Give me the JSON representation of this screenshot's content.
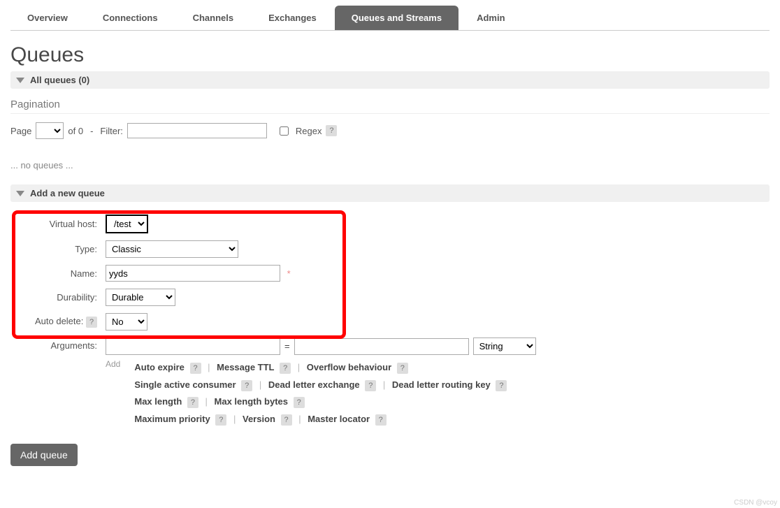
{
  "tabs": {
    "overview": "Overview",
    "connections": "Connections",
    "channels": "Channels",
    "exchanges": "Exchanges",
    "queues": "Queues and Streams",
    "admin": "Admin"
  },
  "page_title": "Queues",
  "section_all_queues": "All queues (0)",
  "pagination": {
    "heading": "Pagination",
    "page_label": "Page",
    "of_text": "of 0",
    "dash": "-",
    "filter_label": "Filter:",
    "regex_label": "Regex",
    "help": "?"
  },
  "no_queues": "... no queues ...",
  "section_add": "Add a new queue",
  "form": {
    "vhost_label": "Virtual host:",
    "vhost_value": "/test",
    "type_label": "Type:",
    "type_value": "Classic",
    "name_label": "Name:",
    "name_value": "yyds",
    "required": "*",
    "durability_label": "Durability:",
    "durability_value": "Durable",
    "autodelete_label": "Auto delete:",
    "autodelete_value": "No",
    "help": "?",
    "arguments_label": "Arguments:",
    "equals": "=",
    "argtype_value": "String",
    "add_text": "Add"
  },
  "shortcuts": {
    "auto_expire": "Auto expire",
    "message_ttl": "Message TTL",
    "overflow": "Overflow behaviour",
    "single_active": "Single active consumer",
    "dlx": "Dead letter exchange",
    "dlrk": "Dead letter routing key",
    "max_length": "Max length",
    "max_length_bytes": "Max length bytes",
    "max_priority": "Maximum priority",
    "version": "Version",
    "master_locator": "Master locator",
    "help": "?"
  },
  "submit_label": "Add queue",
  "watermark": "CSDN @vcoy"
}
